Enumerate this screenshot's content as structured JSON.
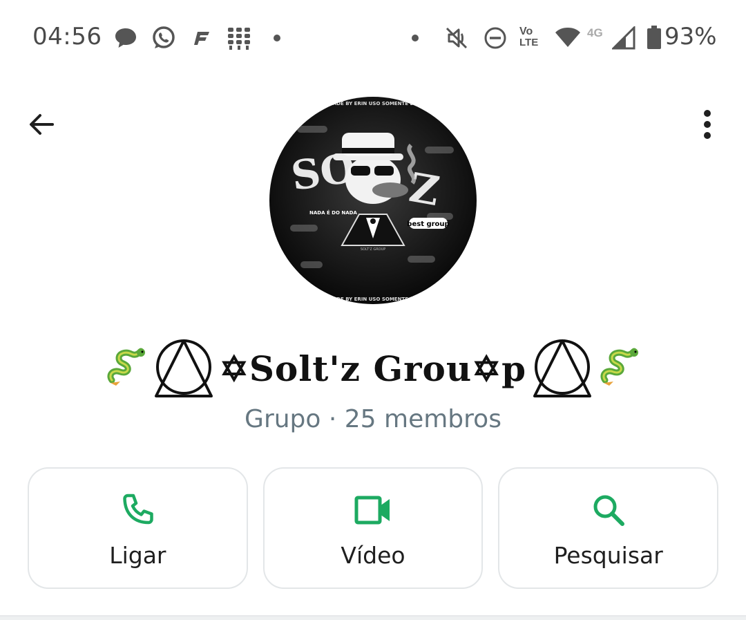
{
  "status_bar": {
    "time": "04:56",
    "icons_left": [
      "chat-bubble-icon",
      "whatsapp-icon",
      "ff-icon",
      "grid-app-icon",
      "dot"
    ],
    "icons_right": [
      "dot",
      "mute-icon",
      "dnd-icon",
      "volte-icon",
      "wifi-icon",
      "4g-signal-icon",
      "battery-icon"
    ],
    "volte_label_top": "Vo",
    "volte_label_bottom": "LTE",
    "network_label": "4G",
    "battery": "93%"
  },
  "header": {
    "back_icon": "arrow-left-icon",
    "menu_icon": "more-vertical-icon"
  },
  "avatar": {
    "texts": [
      "MADE BY ERIN USO SOMENTE DO",
      "NADA É DO NADA",
      "best group",
      "SOLT'Z GROUP"
    ]
  },
  "group": {
    "name": "✡Solt'z Grou✡p",
    "subtitle": "Grupo · 25 membros"
  },
  "actions": [
    {
      "label": "Ligar",
      "icon": "phone-icon"
    },
    {
      "label": "Vídeo",
      "icon": "video-camera-icon"
    },
    {
      "label": "Pesquisar",
      "icon": "search-icon"
    }
  ],
  "colors": {
    "accent": "#1DAA61",
    "subtitle": "#667781",
    "border": "#e3e6e8"
  }
}
